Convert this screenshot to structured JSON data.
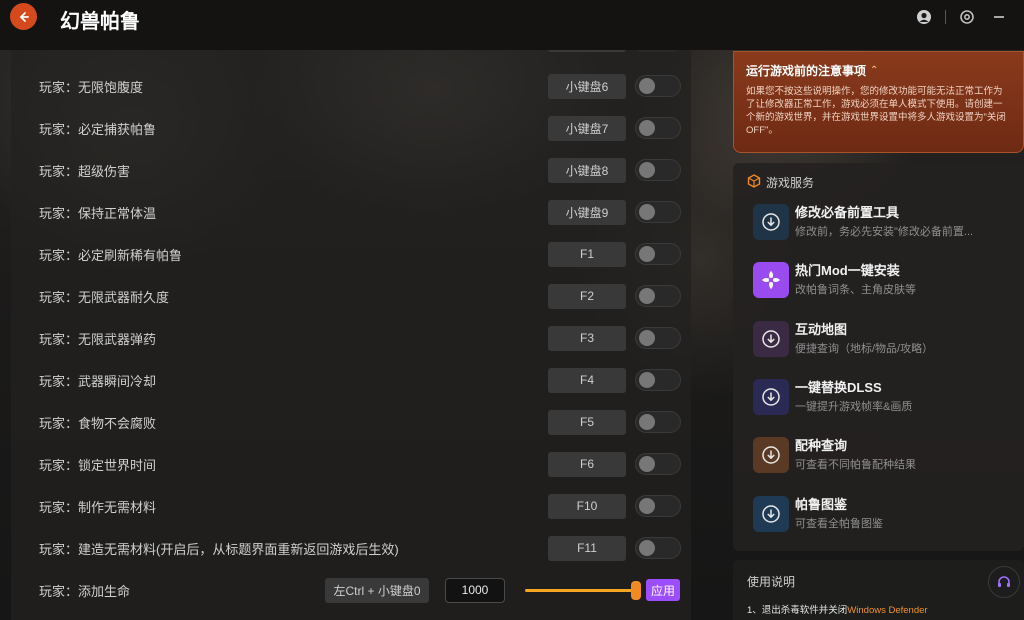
{
  "app": {
    "title": "幻兽帕鲁"
  },
  "titlebar": {
    "icons": [
      "back-arrow-icon",
      "avatar-icon",
      "settings-icon",
      "minimize-icon"
    ]
  },
  "cheats": [
    {
      "label": "玩家：无限饱腹度",
      "key": "小键盘6"
    },
    {
      "label": "玩家：必定捕获帕鲁",
      "key": "小键盘7"
    },
    {
      "label": "玩家：超级伤害",
      "key": "小键盘8"
    },
    {
      "label": "玩家：保持正常体温",
      "key": "小键盘9"
    },
    {
      "label": "玩家：必定刷新稀有帕鲁",
      "key": "F1"
    },
    {
      "label": "玩家：无限武器耐久度",
      "key": "F2"
    },
    {
      "label": "玩家：无限武器弹药",
      "key": "F3"
    },
    {
      "label": "玩家：武器瞬间冷却",
      "key": "F4"
    },
    {
      "label": "玩家：食物不会腐败",
      "key": "F5"
    },
    {
      "label": "玩家：锁定世界时间",
      "key": "F6"
    },
    {
      "label": "玩家：制作无需材料",
      "key": "F10"
    },
    {
      "label": "玩家：建造无需材料(开启后，从标题界面重新返回游戏后生效)",
      "key": "F11"
    }
  ],
  "add_health": {
    "label": "玩家：添加生命",
    "key": "左Ctrl + 小键盘0",
    "value": "1000",
    "slider_fraction": 1.0,
    "apply_label": "应用"
  },
  "notice": {
    "title": "运行游戏前的注意事项",
    "body": "如果您不按这些说明操作，您的修改功能可能无法正常工作为了让修改器正常工作，游戏必须在单人模式下使用。请创建一个新的游戏世界，并在游戏世界设置中将多人游戏设置为\"关闭OFF\"。"
  },
  "services": {
    "heading": "游戏服务",
    "items": [
      {
        "title": "修改必备前置工具",
        "subtitle": "修改前，务必先安装\"修改必备前置...",
        "icon": "download-icon",
        "color": "#1f3447"
      },
      {
        "title": "热门Mod一键安装",
        "subtitle": "改帕鲁词条、主角皮肤等",
        "icon": "mod-icon",
        "color": "#9a4bf0"
      },
      {
        "title": "互动地图",
        "subtitle": "便捷查询（地标/物品/攻略）",
        "icon": "download-icon",
        "color": "#3a2a44"
      },
      {
        "title": "一键替换DLSS",
        "subtitle": "一键提升游戏帧率&画质",
        "icon": "download-icon",
        "color": "#2b2a55"
      },
      {
        "title": "配种查询",
        "subtitle": "可查看不同帕鲁配种结果",
        "icon": "download-icon",
        "color": "#5a3a24"
      },
      {
        "title": "帕鲁图鉴",
        "subtitle": "可查看全帕鲁图鉴",
        "icon": "download-icon",
        "color": "#1f3a55"
      }
    ]
  },
  "guide": {
    "title": "使用说明",
    "line_prefix": "1、退出杀毒软件并关闭",
    "line_highlight": "Windows Defender"
  },
  "colors": {
    "accent": "#d44a1c",
    "purple": "#9b4dff",
    "orange": "#f5a623"
  }
}
